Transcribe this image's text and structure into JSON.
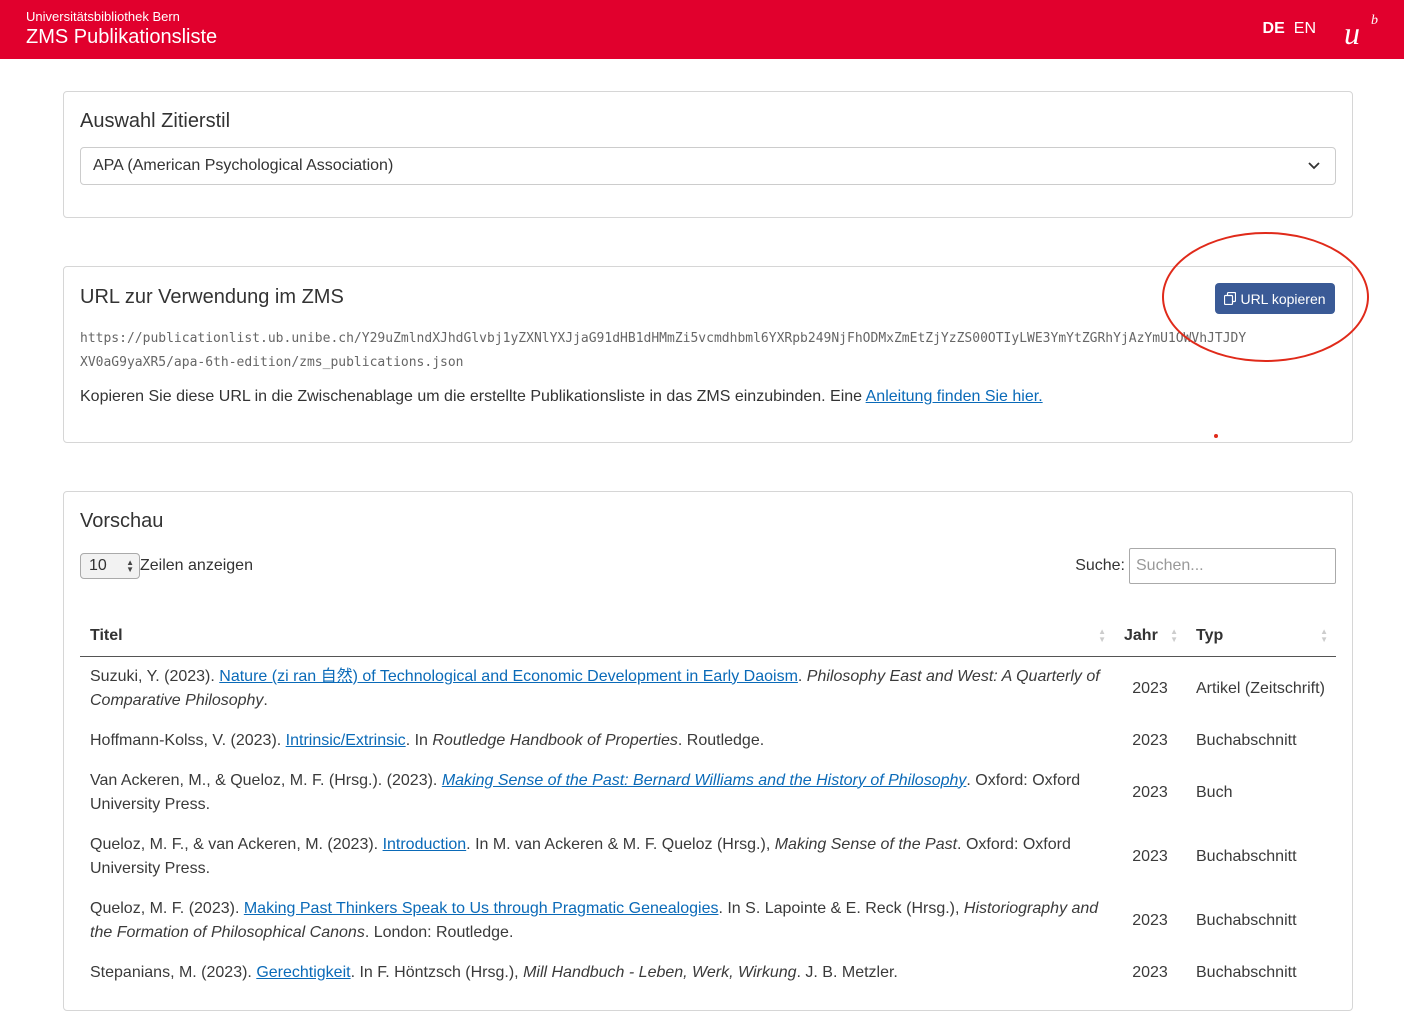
{
  "header": {
    "org": "Universitätsbibliothek Bern",
    "app_title": "ZMS Publikationsliste",
    "lang_de": "DE",
    "lang_en": "EN",
    "brand_color": "#e1002d"
  },
  "citation": {
    "heading": "Auswahl Zitierstil",
    "selected": "APA (American Psychological Association)"
  },
  "url_section": {
    "heading": "URL zur Verwendung im ZMS",
    "copy_button": "URL kopieren",
    "url_line1": "https://publicationlist.ub.unibe.ch/Y29uZmlndXJhdGlvbj1yZXNlYXJjaG91dHB1dHMmZi5vcmdhbml6YXRpb249NjFhODMxZmEtZjYzZS00OTIyLWE3YmYtZGRhYjAzYmU1OWVhJTJDY",
    "url_line2": "XV0aG9yaXR5/apa-6th-edition/zms_publications.json",
    "hint_text": "Kopieren Sie diese URL in die Zwischenablage um die erstellte Publikationsliste in das ZMS einzubinden. Eine ",
    "hint_link": "Anleitung finden Sie hier."
  },
  "preview": {
    "heading": "Vorschau",
    "rows_count": "10",
    "rows_label": "Zeilen anzeigen",
    "search_label": "Suche:",
    "search_placeholder": "Suchen...",
    "columns": [
      "Titel",
      "Jahr",
      "Typ"
    ],
    "rows": [
      {
        "pre": "Suzuki, Y. (2023). ",
        "link": "Nature (zi ran 自然) of Technological and Economic Development in Early Daoism",
        "link_italic": false,
        "post": ". ",
        "italic": "Philosophy East and West: A Quarterly of Comparative Philosophy",
        "tail": ".",
        "year": "2023",
        "type": "Artikel (Zeitschrift)"
      },
      {
        "pre": "Hoffmann-Kolss, V. (2023). ",
        "link": "Intrinsic/Extrinsic",
        "link_italic": false,
        "post": ". In ",
        "italic": "Routledge Handbook of Properties",
        "tail": ". Routledge.",
        "year": "2023",
        "type": "Buchabschnitt"
      },
      {
        "pre": "Van Ackeren, M., & Queloz, M. F. (Hrsg.). (2023). ",
        "link": "Making Sense of the Past: Bernard Williams and the History of Philosophy",
        "link_italic": true,
        "post": ". Oxford: Oxford University Press.",
        "italic": "",
        "tail": "",
        "year": "2023",
        "type": "Buch"
      },
      {
        "pre": "Queloz, M. F., & van Ackeren, M. (2023). ",
        "link": "Introduction",
        "link_italic": false,
        "post": ". In M. van Ackeren & M. F. Queloz (Hrsg.), ",
        "italic": "Making Sense of the Past",
        "tail": ". Oxford: Oxford University Press.",
        "year": "2023",
        "type": "Buchabschnitt"
      },
      {
        "pre": "Queloz, M. F. (2023). ",
        "link": "Making Past Thinkers Speak to Us through Pragmatic Genealogies",
        "link_italic": false,
        "post": ". In S. Lapointe & E. Reck (Hrsg.), ",
        "italic": "Historiography and the Formation of Philosophical Canons",
        "tail": ". London: Routledge.",
        "year": "2023",
        "type": "Buchabschnitt"
      },
      {
        "pre": "Stepanians, M. (2023). ",
        "link": "Gerechtigkeit",
        "link_italic": false,
        "post": ". In F. Höntzsch (Hrsg.), ",
        "italic": "Mill Handbuch - Leben, Werk, Wirkung",
        "tail": ". J. B. Metzler.",
        "year": "2023",
        "type": "Buchabschnitt"
      }
    ]
  },
  "annotation_color": "#e02a1a",
  "button_color": "#3a5a96",
  "link_color": "#0a6ab8"
}
